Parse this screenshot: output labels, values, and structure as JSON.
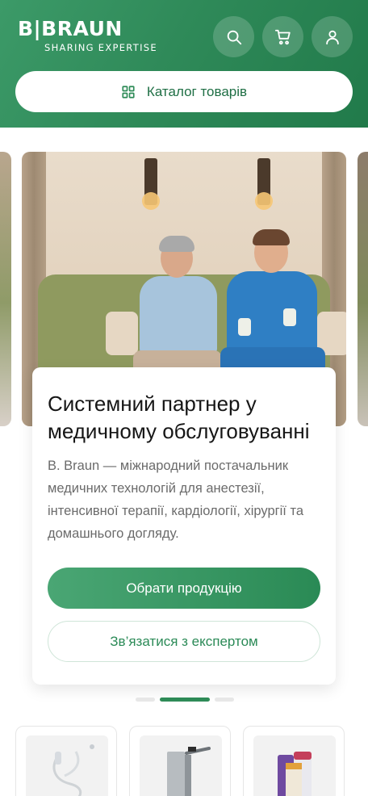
{
  "header": {
    "logo": {
      "brand": "B|BRAUN",
      "tagline": "SHARING EXPERTISE"
    },
    "actions": {
      "search_icon": "search-icon",
      "cart_icon": "cart-icon",
      "user_icon": "user-icon"
    },
    "catalog_button": {
      "icon": "grid-icon",
      "label": "Каталог товарів"
    }
  },
  "hero": {
    "title": "Системний партнер у медичному обслуговуванні",
    "description": "B. Braun — міжнародний постачальник медичних технологій для анестезії, інтенсивної терапії, кардіології, хірургії та домашнього догляду.",
    "primary_button": "Обрати продукцію",
    "secondary_button": "Зв’язатися з експертом"
  },
  "carousel": {
    "total_slides": 3,
    "active_slide": 2
  },
  "colors": {
    "brand_green": "#2e8b57",
    "header_gradient_start": "#3c9a68",
    "header_gradient_end": "#217a4a",
    "secondary_text": "#6b6b6b"
  },
  "products": {
    "items": [
      {
        "icon": "iv-tubing-image"
      },
      {
        "icon": "dispenser-image"
      },
      {
        "icon": "nutrition-bottles-image"
      }
    ]
  }
}
